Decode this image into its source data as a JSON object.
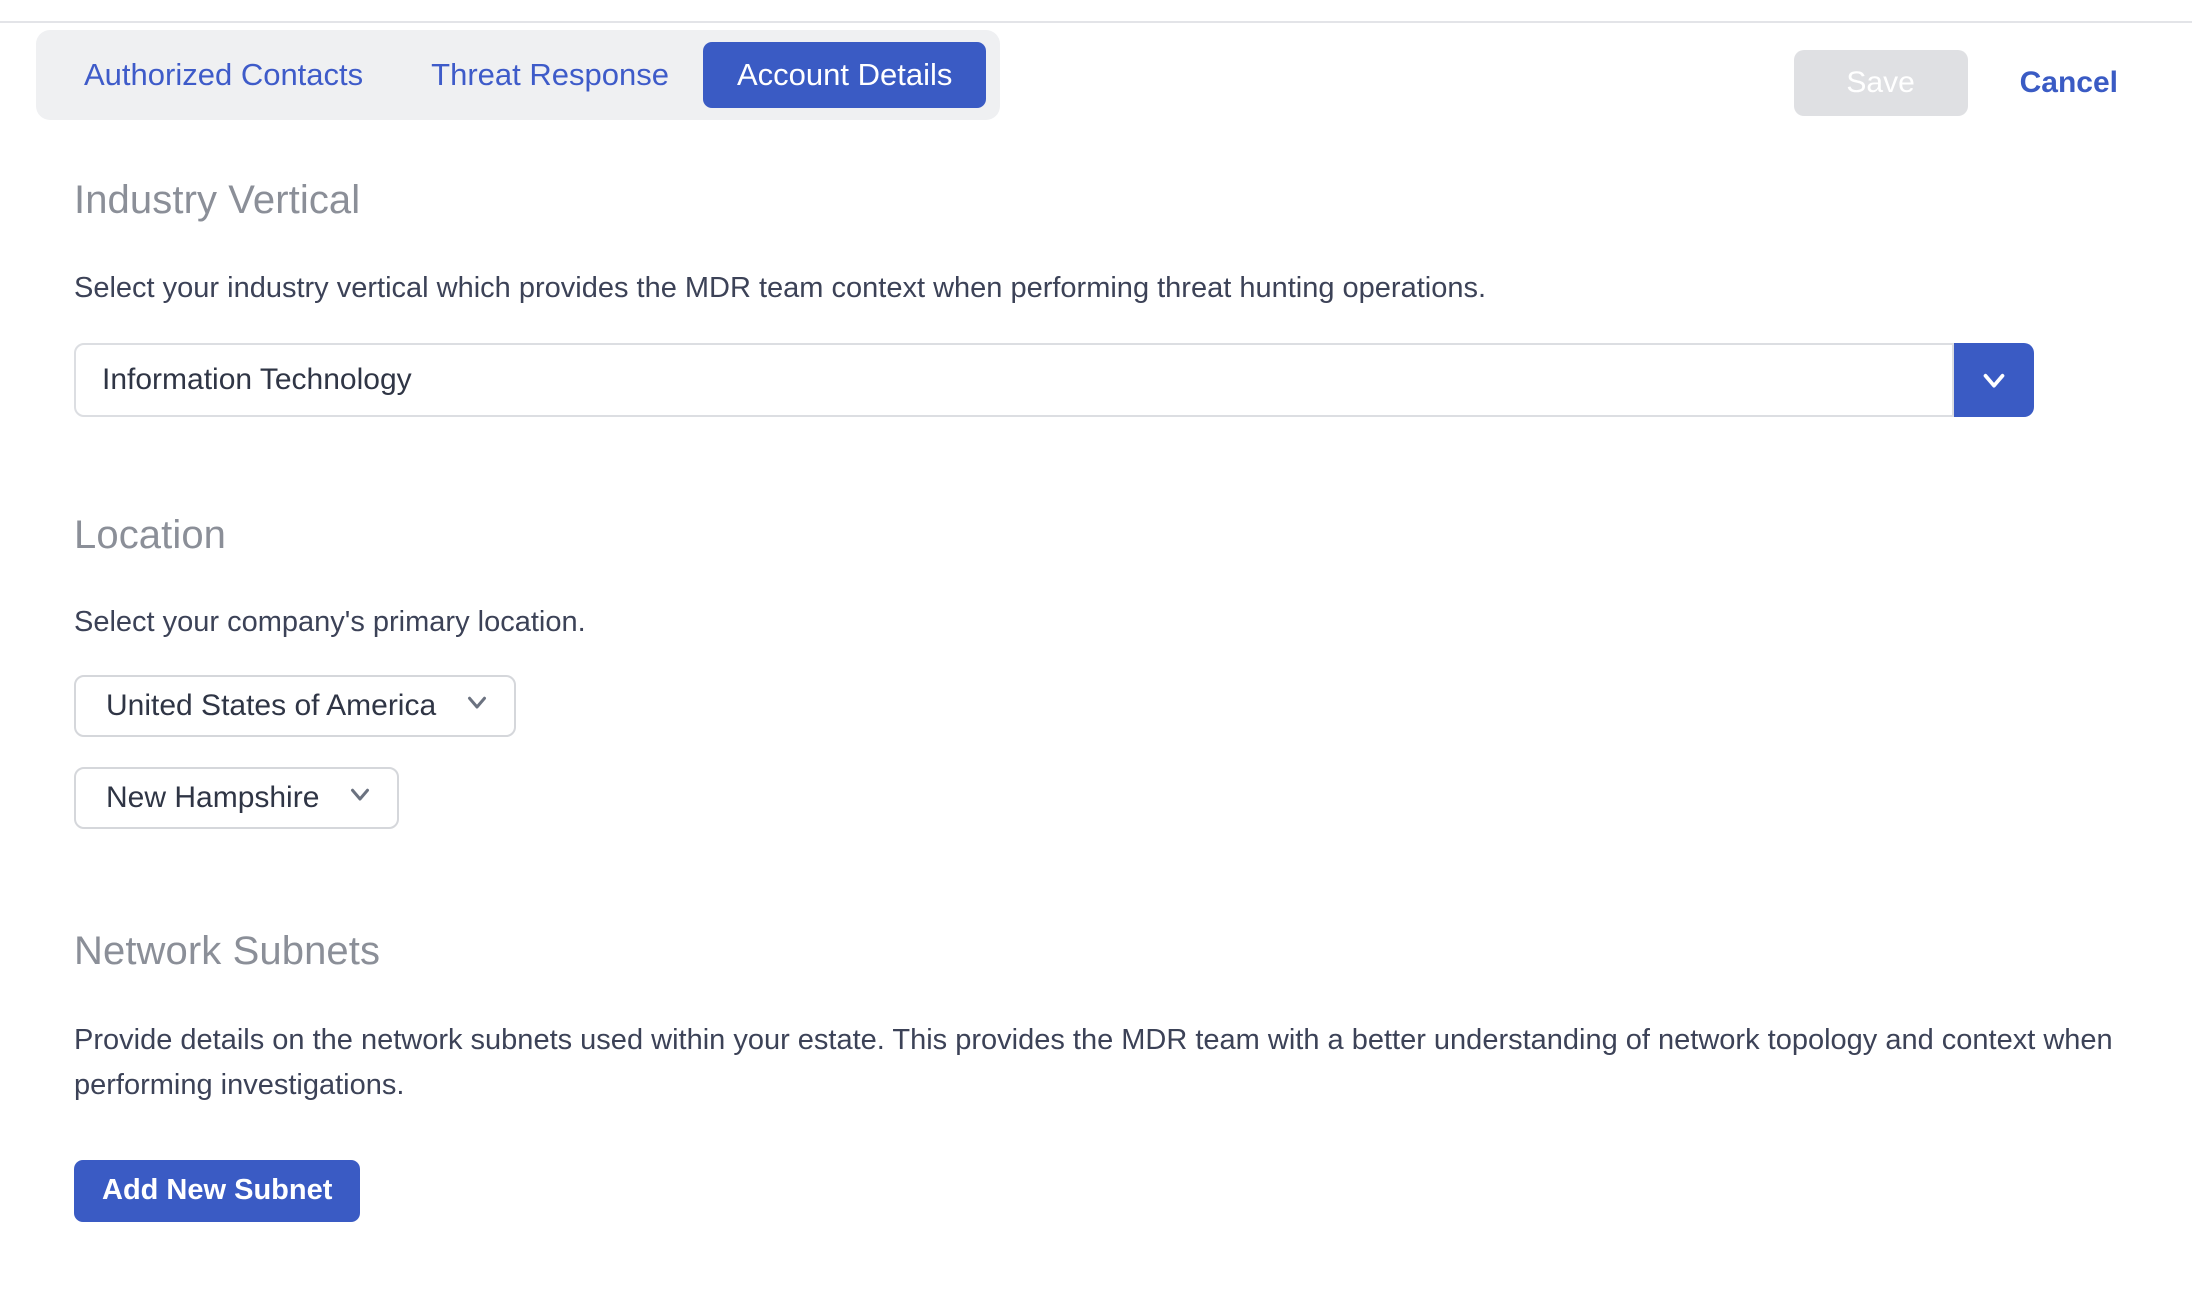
{
  "header": {
    "tabs": [
      {
        "label": "Authorized Contacts",
        "active": false
      },
      {
        "label": "Threat Response",
        "active": false
      },
      {
        "label": "Account Details",
        "active": true
      }
    ],
    "save_label": "Save",
    "cancel_label": "Cancel",
    "save_disabled": true
  },
  "colors": {
    "accent_blue": "#3A5BC4",
    "tab_link_blue": "#3E5BC9",
    "tab_group_bg": "#EFF0F2",
    "save_disabled_bg": "#DFE0E3",
    "heading_gray": "#8B8F98",
    "body_text": "#3C4257",
    "field_border": "#DCDEE2"
  },
  "sections": {
    "industry": {
      "title": "Industry Vertical",
      "description": "Select your industry vertical which provides the MDR team context when performing threat hunting operations.",
      "value": "Information Technology",
      "dropdown_icon": "chevron-down-icon"
    },
    "location": {
      "title": "Location",
      "description": "Select your company's primary location.",
      "country_value": "United States of America",
      "state_value": "New Hampshire",
      "dropdown_icon": "chevron-down-icon"
    },
    "subnets": {
      "title": "Network Subnets",
      "description": "Provide details on the network subnets used within your estate. This provides the MDR team with a better understanding of network topology and context when performing investigations.",
      "add_button_label": "Add New Subnet"
    }
  }
}
